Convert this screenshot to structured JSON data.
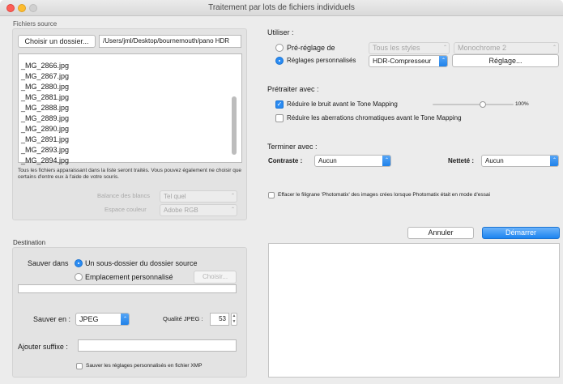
{
  "window": {
    "title": "Traitement par lots de fichiers individuels"
  },
  "source": {
    "group_title": "Fichiers source",
    "choose_button": "Choisir un dossier...",
    "path": "/Users/jml/Desktop/bournemouth/pano HDR",
    "files": [
      "_MG_2866.jpg",
      "_MG_2867.jpg",
      "_MG_2880.jpg",
      "_MG_2881.jpg",
      "_MG_2888.jpg",
      "_MG_2889.jpg",
      "_MG_2890.jpg",
      "_MG_2891.jpg",
      "_MG_2893.jpg",
      "_MG_2894.jpg"
    ],
    "note": "Tous les fichiers apparaissant dans la liste seront traités. Vous pouvez également ne choisir que certains d'entre eux à l'aide de votre souris.",
    "white_balance_label": "Balance des blancs",
    "white_balance_value": "Tel quel",
    "color_space_label": "Espace couleur",
    "color_space_value": "Adobe RGB"
  },
  "destination": {
    "group_title": "Destination",
    "save_in_label": "Sauver dans",
    "subfolder_option": "Un sous-dossier du dossier source",
    "custom_location_option": "Emplacement personnalisé",
    "choose_button": "Choisir...",
    "path_value": "",
    "save_as_label": "Sauver en :",
    "format_value": "JPEG",
    "jpeg_quality_label": "Qualité JPEG :",
    "jpeg_quality_value": "53",
    "suffix_label": "Ajouter suffixe :",
    "suffix_value": "",
    "save_xmp_label": "Sauver les réglages personnalisés en fichier XMP"
  },
  "use": {
    "section_title": "Utiliser :",
    "preset_option": "Pré-réglage de",
    "preset_styles_value": "Tous les styles",
    "preset_value": "Monochrome 2",
    "custom_option": "Réglages personnalisés",
    "custom_value": "HDR-Compresseur",
    "settings_button": "Réglage..."
  },
  "preprocess": {
    "section_title": "Prétraiter avec :",
    "reduce_noise_label": "Réduire le bruit avant le Tone Mapping",
    "noise_percent": "100%",
    "chromatic_label": "Réduire les aberrations chromatiques avant le Tone Mapping"
  },
  "finish": {
    "section_title": "Terminer avec :",
    "contrast_label": "Contraste :",
    "contrast_value": "Aucun",
    "sharpness_label": "Netteté :",
    "sharpness_value": "Aucun"
  },
  "watermark_label": "Effacer le filigrane 'Photomatix' des images crées lorsque Photomatix était en mode d'essai",
  "buttons": {
    "cancel": "Annuler",
    "start": "Démarrer"
  },
  "colors": {
    "accent": "#2a8bf2",
    "close": "#fc5f57",
    "minimize": "#fdbc2e",
    "zoom": "#cfcfcf"
  }
}
